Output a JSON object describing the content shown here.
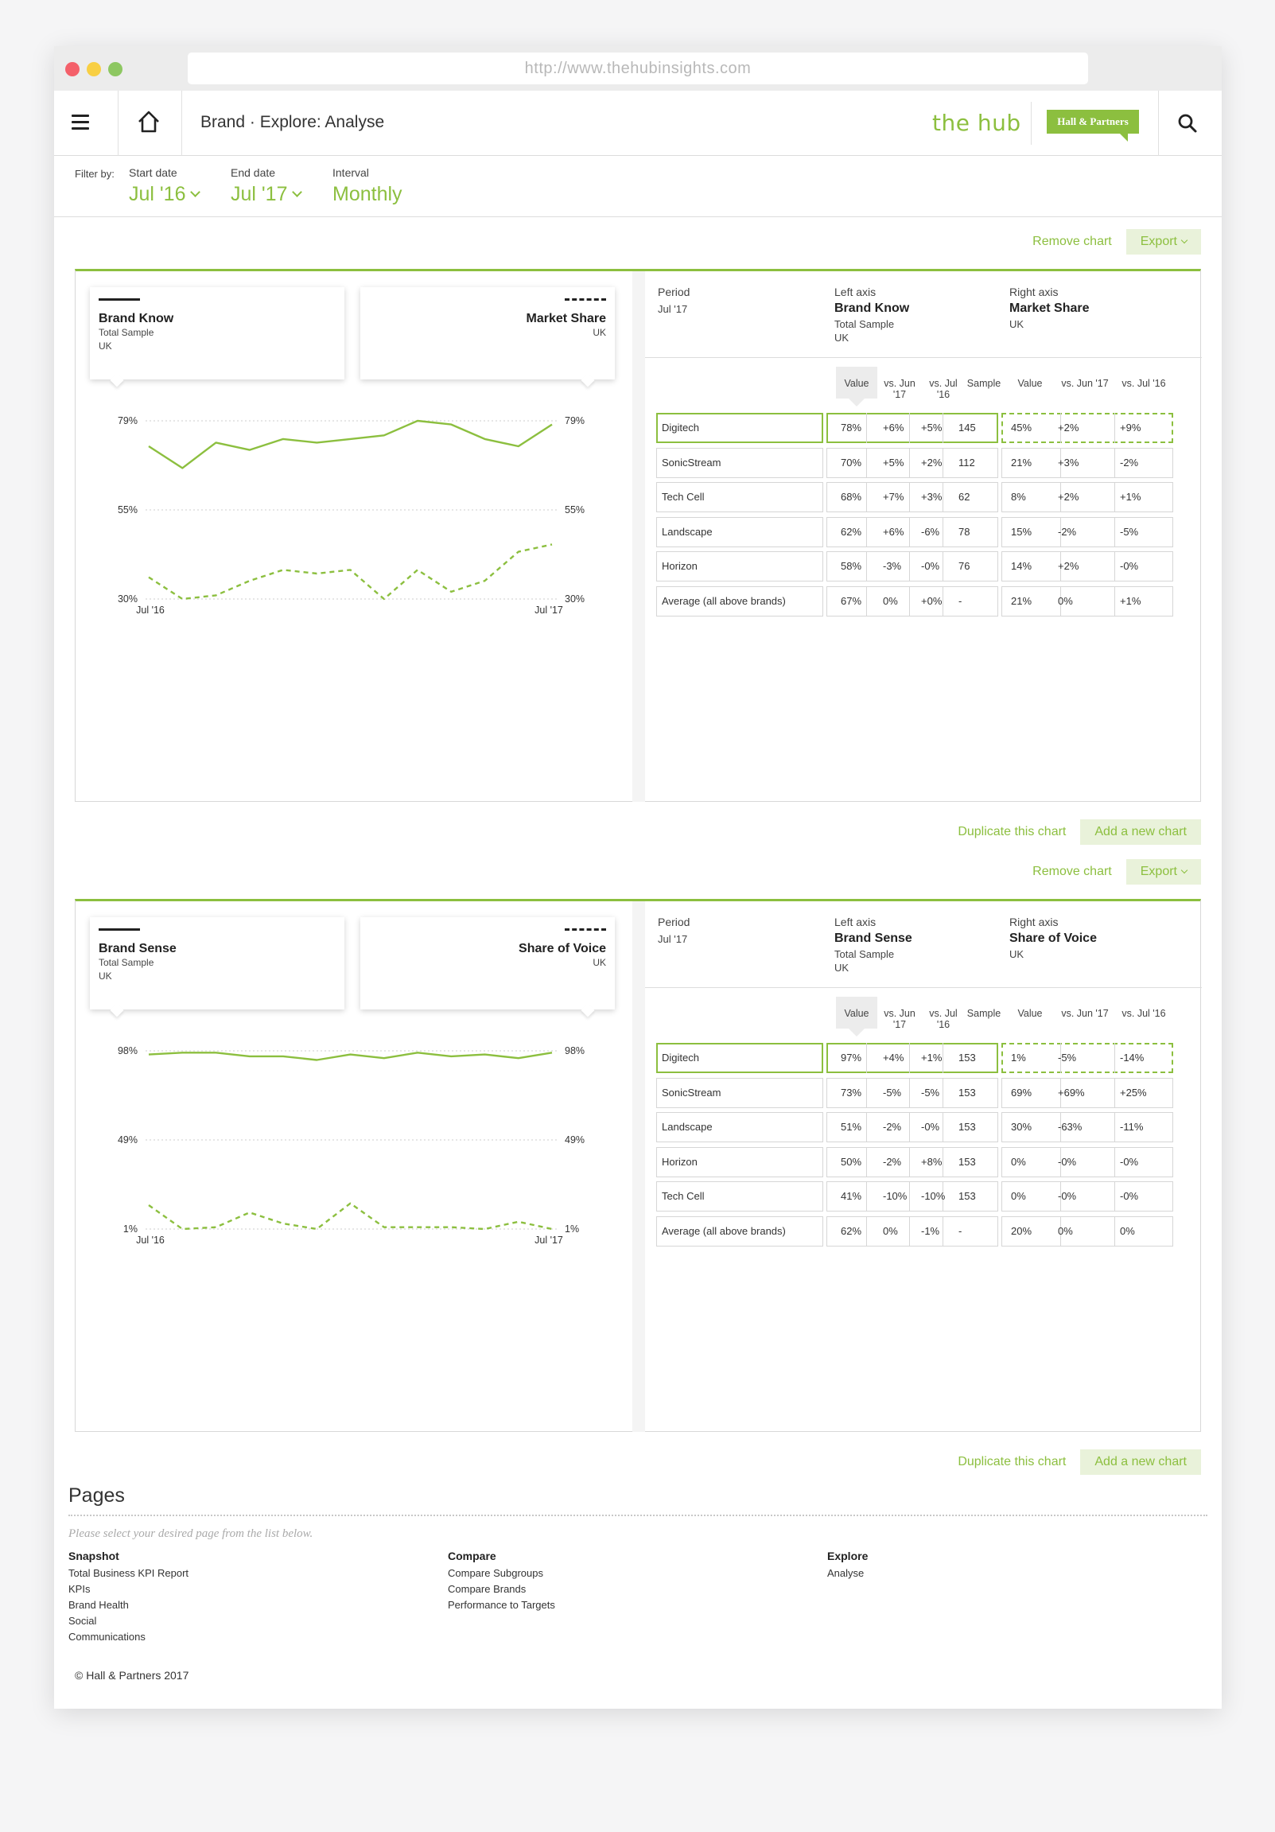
{
  "browser": {
    "url": "http://www.thehubinsights.com"
  },
  "header": {
    "breadcrumb": "Brand · Explore: Analyse",
    "logo": "the hub",
    "partner_logo": "Hall & Partners"
  },
  "filters": {
    "label": "Filter by:",
    "start": {
      "label": "Start date",
      "value": "Jul '16"
    },
    "end": {
      "label": "End date",
      "value": "Jul '17"
    },
    "interval": {
      "label": "Interval",
      "value": "Monthly"
    }
  },
  "actions": {
    "remove": "Remove chart",
    "export": "Export",
    "duplicate": "Duplicate this chart",
    "add": "Add a new chart"
  },
  "table_headers": {
    "period": "Period",
    "left_axis": "Left axis",
    "right_axis": "Right axis",
    "value": "Value",
    "vs_jun_1": "vs. Jun",
    "vs_jun_2": "'17",
    "vs_jul_1": "vs. Jul",
    "vs_jul_2": "'16",
    "sample": "Sample",
    "value_r": "Value",
    "vs_jun_r": "vs. Jun '17",
    "vs_jul_r": "vs. Jul '16"
  },
  "charts": [
    {
      "left_card": {
        "title": "Brand Know",
        "sub1": "Total Sample",
        "sub2": "UK"
      },
      "right_card": {
        "title": "Market Share",
        "sub1": "UK"
      },
      "meta": {
        "period": "Jul '17",
        "left_title": "Brand Know",
        "left_sub1": "Total Sample",
        "left_sub2": "UK",
        "right_title": "Market Share",
        "right_sub1": "UK"
      },
      "rows": [
        [
          "Digitech",
          "78%",
          "+6%",
          "+5%",
          "145",
          "45%",
          "+2%",
          "+9%"
        ],
        [
          "SonicStream",
          "70%",
          "+5%",
          "+2%",
          "112",
          "21%",
          "+3%",
          "-2%"
        ],
        [
          "Tech Cell",
          "68%",
          "+7%",
          "+3%",
          "62",
          "8%",
          "+2%",
          "+1%"
        ],
        [
          "Landscape",
          "62%",
          "+6%",
          "-6%",
          "78",
          "15%",
          "-2%",
          "-5%"
        ],
        [
          "Horizon",
          "58%",
          "-3%",
          "-0%",
          "76",
          "14%",
          "+2%",
          "-0%"
        ],
        [
          "Average (all above brands)",
          "67%",
          "0%",
          "+0%",
          "-",
          "21%",
          "0%",
          "+1%"
        ]
      ]
    },
    {
      "left_card": {
        "title": "Brand Sense",
        "sub1": "Total Sample",
        "sub2": "UK"
      },
      "right_card": {
        "title": "Share of Voice",
        "sub1": "UK"
      },
      "meta": {
        "period": "Jul '17",
        "left_title": "Brand Sense",
        "left_sub1": "Total Sample",
        "left_sub2": "UK",
        "right_title": "Share of Voice",
        "right_sub1": "UK"
      },
      "rows": [
        [
          "Digitech",
          "97%",
          "+4%",
          "+1%",
          "153",
          "1%",
          "-5%",
          "-14%"
        ],
        [
          "SonicStream",
          "73%",
          "-5%",
          "-5%",
          "153",
          "69%",
          "+69%",
          "+25%"
        ],
        [
          "Landscape",
          "51%",
          "-2%",
          "-0%",
          "153",
          "30%",
          "-63%",
          "-11%"
        ],
        [
          "Horizon",
          "50%",
          "-2%",
          "+8%",
          "153",
          "0%",
          "-0%",
          "-0%"
        ],
        [
          "Tech Cell",
          "41%",
          "-10%",
          "-10%",
          "153",
          "0%",
          "-0%",
          "-0%"
        ],
        [
          "Average (all above brands)",
          "62%",
          "0%",
          "-1%",
          "-",
          "20%",
          "0%",
          "0%"
        ]
      ]
    }
  ],
  "chart_data": [
    {
      "type": "line",
      "x": [
        "Jul '16",
        "Aug '16",
        "Sep '16",
        "Oct '16",
        "Nov '16",
        "Dec '16",
        "Jan '17",
        "Feb '17",
        "Mar '17",
        "Apr '17",
        "May '17",
        "Jun '17",
        "Jul '17"
      ],
      "xticks": [
        "Jul '16",
        "Jul '17"
      ],
      "left_ticks": [
        "79%",
        "55%",
        "30%"
      ],
      "right_ticks": [
        "79%",
        "55%",
        "30%"
      ],
      "ylim_left": [
        30,
        79
      ],
      "ylim_right": [
        30,
        79
      ],
      "series": [
        {
          "name": "Brand Know",
          "axis": "left",
          "style": "solid",
          "values": [
            72,
            66,
            73,
            71,
            74,
            73,
            74,
            75,
            79,
            78,
            74,
            72,
            78
          ]
        },
        {
          "name": "Market Share",
          "axis": "right",
          "style": "dashed",
          "values": [
            36,
            30,
            31,
            35,
            38,
            37,
            38,
            30,
            38,
            32,
            35,
            43,
            45
          ]
        }
      ],
      "colors": {
        "line": "#8cbf3f",
        "grid": "#d8d8d8"
      }
    },
    {
      "type": "line",
      "x": [
        "Jul '16",
        "Aug '16",
        "Sep '16",
        "Oct '16",
        "Nov '16",
        "Dec '16",
        "Jan '17",
        "Feb '17",
        "Mar '17",
        "Apr '17",
        "May '17",
        "Jun '17",
        "Jul '17"
      ],
      "xticks": [
        "Jul '16",
        "Jul '17"
      ],
      "left_ticks": [
        "98%",
        "49%",
        "1%"
      ],
      "right_ticks": [
        "98%",
        "49%",
        "1%"
      ],
      "ylim_left": [
        1,
        98
      ],
      "ylim_right": [
        1,
        98
      ],
      "series": [
        {
          "name": "Brand Sense",
          "axis": "left",
          "style": "solid",
          "values": [
            96,
            97,
            97,
            95,
            95,
            93,
            96,
            94,
            97,
            95,
            96,
            94,
            97
          ]
        },
        {
          "name": "Share of Voice",
          "axis": "right",
          "style": "dashed",
          "values": [
            14,
            1,
            2,
            10,
            4,
            1,
            15,
            2,
            2,
            2,
            1,
            5,
            1
          ]
        }
      ],
      "colors": {
        "line": "#8cbf3f",
        "grid": "#d8d8d8"
      }
    }
  ],
  "pages": {
    "title": "Pages",
    "hint": "Please select your desired page from the list below.",
    "columns": [
      {
        "heading": "Snapshot",
        "items": [
          "Total Business KPI Report",
          "KPIs",
          "Brand Health",
          "Social",
          "Communications"
        ]
      },
      {
        "heading": "Compare",
        "items": [
          "Compare Subgroups",
          "Compare Brands",
          "Performance to Targets"
        ]
      },
      {
        "heading": "Explore",
        "items": [
          "Analyse"
        ]
      }
    ]
  },
  "footer": {
    "copyright": "© Hall & Partners 2017"
  }
}
